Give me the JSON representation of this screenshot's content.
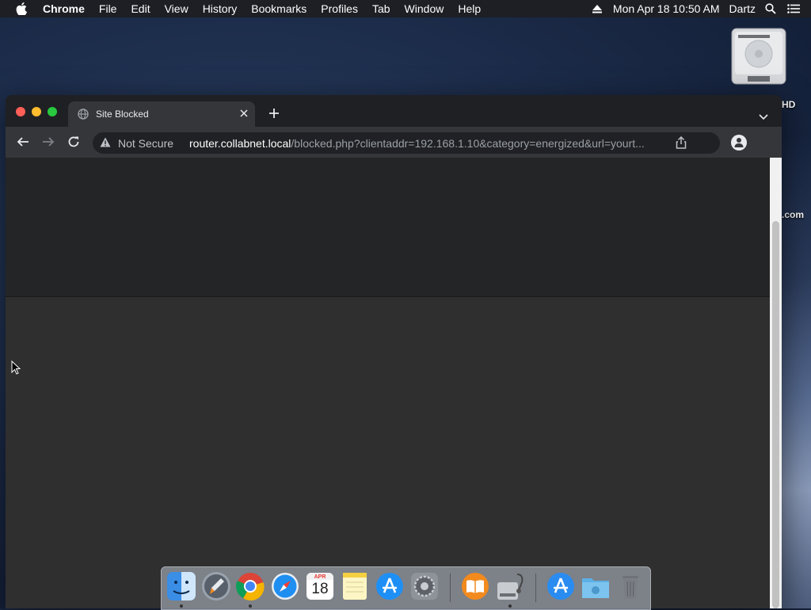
{
  "menubar": {
    "app_name": "Chrome",
    "items": [
      "File",
      "Edit",
      "View",
      "History",
      "Bookmarks",
      "Profiles",
      "Tab",
      "Window",
      "Help"
    ],
    "datetime": "Mon Apr 18  10:50 AM",
    "user": "Dartz"
  },
  "desktop": {
    "hd_label": "HD",
    "com_label": ".com"
  },
  "browser": {
    "tab_title": "Site Blocked",
    "security_label": "Not Secure",
    "url_host": "router.collabnet.local",
    "url_path": "/blocked.php?clientaddr=192.168.1.10&category=energized&url=yourt..."
  },
  "dock": {
    "apps": [
      "finder",
      "launchpad",
      "chrome",
      "safari",
      "calendar",
      "notes",
      "app-store",
      "system-preferences",
      "books",
      "disk-utility",
      "app-store-2",
      "downloads-folder",
      "trash"
    ],
    "calendar_month": "APR",
    "calendar_day": "18"
  },
  "colors": {
    "menubar": "#1d1f24",
    "tabstrip": "#1f2023",
    "toolbar": "#35363a",
    "omnibox": "#202124",
    "content": "#2f2f2f",
    "banner": "#242526"
  }
}
